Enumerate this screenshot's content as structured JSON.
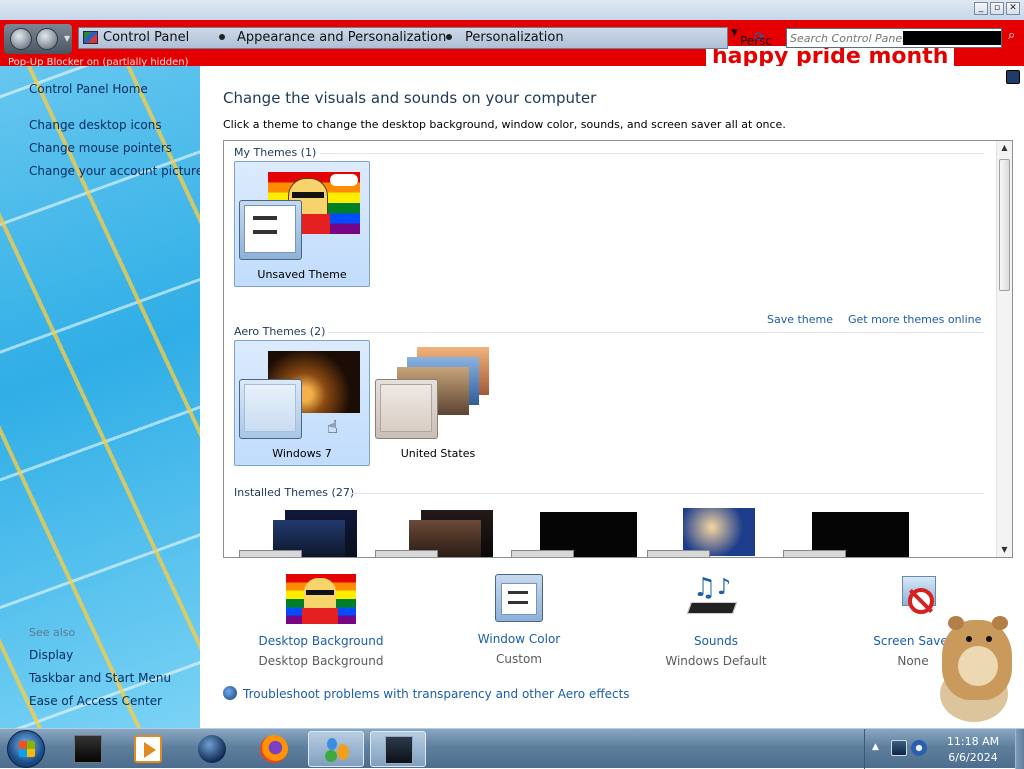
{
  "colors": {
    "address_band": "#e40000",
    "link": "#1a5ea9",
    "heading": "#1e395b",
    "left_pane": "#2faee6",
    "selected_tile": "#c1dcfc"
  },
  "titlebar": {
    "min_icon": "minimize-icon",
    "max_icon": "maximize-icon",
    "close_icon": "close-icon"
  },
  "address": {
    "crumbs": [
      "Control Panel",
      "Appearance and Personalization",
      "Personalization"
    ],
    "tail_text": "Persc",
    "search_placeholder": "Search Control Panel",
    "underlying_text": "Pop-Up Blocker on (partially hidden)",
    "banner_text": "happy pride month"
  },
  "leftpane": {
    "home": "Control Panel Home",
    "links": [
      "Change desktop icons",
      "Change mouse pointers",
      "Change your account picture"
    ],
    "see_also_label": "See also",
    "see_also": [
      "Display",
      "Taskbar and Start Menu",
      "Ease of Access Center"
    ]
  },
  "main": {
    "heading": "Change the visuals and sounds on your computer",
    "subheading": "Click a theme to change the desktop background, window color, sounds, and screen saver all at once.",
    "groups": {
      "my_themes": "My Themes (1)",
      "aero_themes": "Aero Themes (2)",
      "installed_themes": "Installed Themes (27)"
    },
    "tiles": {
      "unsaved": "Unsaved Theme",
      "windows7": "Windows 7",
      "united_states": "United States"
    },
    "links": {
      "save_theme": "Save theme",
      "more_online": "Get more themes online"
    },
    "bottom": [
      {
        "title": "Desktop Background",
        "value": "Desktop Background",
        "icon": "desktop-background-icon"
      },
      {
        "title": "Window Color",
        "value": "Custom",
        "icon": "window-color-icon"
      },
      {
        "title": "Sounds",
        "value": "Windows Default",
        "icon": "sounds-icon"
      },
      {
        "title": "Screen Saver",
        "value": "None",
        "icon": "screen-saver-icon"
      }
    ],
    "troubleshoot": "Troubleshoot problems with transparency and other Aero effects"
  },
  "taskbar": {
    "apps": [
      "app-dark-window-icon",
      "media-player-icon",
      "globe-app-icon",
      "firefox-icon",
      "control-panel-icon",
      "window-app-icon"
    ],
    "time": "11:18 AM",
    "date": "6/6/2024"
  }
}
